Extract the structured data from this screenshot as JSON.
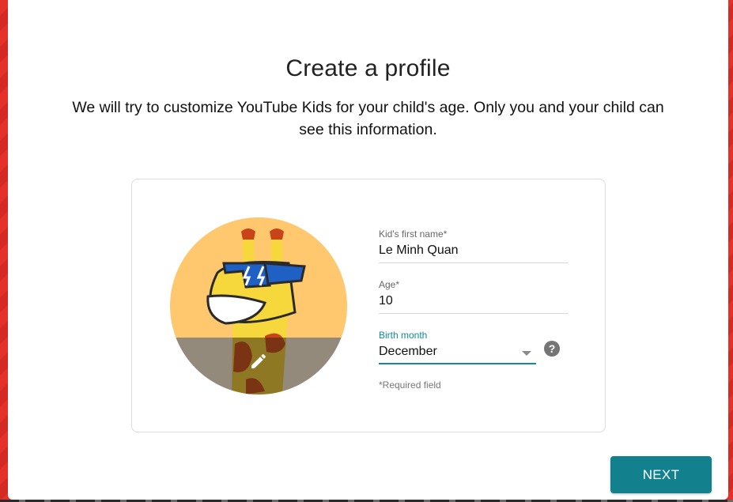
{
  "dialog": {
    "title": "Create a profile",
    "subtitle": "We will try to customize YouTube Kids for your child's age. Only you and your child can see this information."
  },
  "form": {
    "name_label": "Kid's first name*",
    "name_value": "Le Minh Quan",
    "age_label": "Age*",
    "age_value": "10",
    "month_label": "Birth month",
    "month_value": "December",
    "required_note": "*Required field"
  },
  "buttons": {
    "next": "NEXT"
  },
  "icons": {
    "avatar": "giraffe-avatar-icon",
    "edit": "pencil-icon",
    "help": "help-icon",
    "dropdown": "chevron-down-icon"
  },
  "colors": {
    "background": "#e4322b",
    "accent": "#13808e",
    "avatar_bg": "#ffc86e"
  }
}
